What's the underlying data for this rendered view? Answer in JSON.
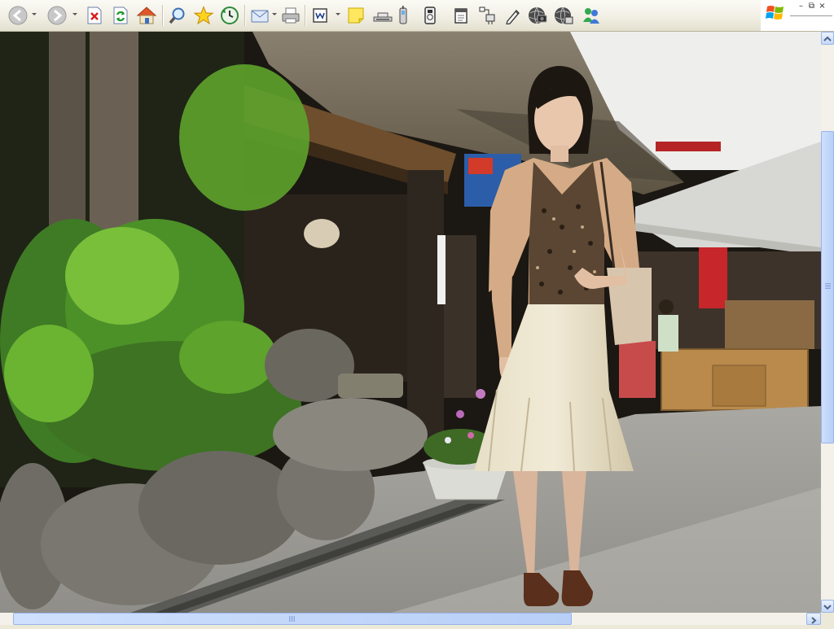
{
  "toolbar": {
    "buttons": [
      {
        "name": "back-button",
        "icon": "back-arrow-icon",
        "dropdown": true
      },
      {
        "name": "forward-button",
        "icon": "forward-arrow-icon",
        "dropdown": true
      },
      {
        "name": "stop-button",
        "icon": "stop-icon"
      },
      {
        "name": "refresh-button",
        "icon": "refresh-icon"
      },
      {
        "name": "home-button",
        "icon": "home-icon"
      },
      {
        "name": "search-button",
        "icon": "magnifier-icon"
      },
      {
        "name": "favorites-button",
        "icon": "star-icon"
      },
      {
        "name": "history-button",
        "icon": "history-icon"
      },
      {
        "name": "mail-button",
        "icon": "mail-icon",
        "dropdown": true
      },
      {
        "name": "print-button",
        "icon": "printer-icon"
      },
      {
        "name": "edit-button",
        "icon": "edit-page-icon",
        "dropdown": true
      },
      {
        "name": "notes-button",
        "icon": "sticky-note-icon"
      },
      {
        "name": "scanner-button",
        "icon": "scanner-icon"
      },
      {
        "name": "mobile-button",
        "icon": "mobile-phone-icon"
      },
      {
        "name": "media-player-button",
        "icon": "media-player-icon"
      },
      {
        "name": "calendar-button",
        "icon": "calendar-icon"
      },
      {
        "name": "research-button",
        "icon": "research-icon"
      },
      {
        "name": "pencil-button",
        "icon": "pencil-icon"
      },
      {
        "name": "globe-camera-button",
        "icon": "globe-camera-icon"
      },
      {
        "name": "globe-tools-button",
        "icon": "globe-tools-icon"
      },
      {
        "name": "messenger-button",
        "icon": "messenger-people-icon"
      }
    ]
  },
  "window": {
    "logo": "windows-flag-icon",
    "controls": [
      {
        "name": "minimize-button",
        "glyph": "–"
      },
      {
        "name": "restore-button",
        "glyph": "⧉"
      },
      {
        "name": "close-button",
        "glyph": "×"
      }
    ]
  },
  "content": {
    "image": "woman-in-front-of-thatched-roof-shop-photo"
  },
  "scrollbars": {
    "vertical_thumb_position": 0.17,
    "horizontal_thumb_position": 0.0
  },
  "colors": {
    "toolbar_bg": "#f1efe4",
    "scroll_thumb": "#c5d8f8",
    "scroll_track": "#f3f1ea"
  }
}
